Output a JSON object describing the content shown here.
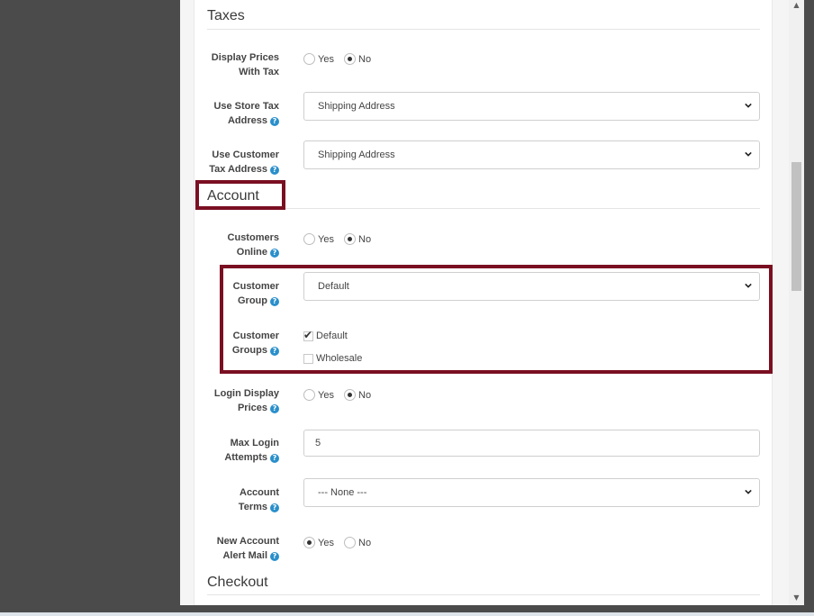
{
  "sections": {
    "taxes": "Taxes",
    "account": "Account",
    "checkout": "Checkout"
  },
  "taxes": {
    "display_prices_with_tax": {
      "label_line1": "Display Prices",
      "label_line2": "With Tax",
      "yes": "Yes",
      "no": "No",
      "selected": "No"
    },
    "use_store_tax_address": {
      "label_line1": "Use Store Tax",
      "label_line2": "Address",
      "value": "Shipping Address"
    },
    "use_customer_tax_address": {
      "label_line1": "Use Customer",
      "label_line2": "Tax Address",
      "value": "Shipping Address"
    }
  },
  "account": {
    "customers_online": {
      "label_line1": "Customers",
      "label_line2": "Online",
      "yes": "Yes",
      "no": "No",
      "selected": "No"
    },
    "customer_group": {
      "label_line1": "Customer",
      "label_line2": "Group",
      "value": "Default"
    },
    "customer_groups": {
      "label_line1": "Customer",
      "label_line2": "Groups",
      "options": [
        {
          "label": "Default",
          "checked": true
        },
        {
          "label": "Wholesale",
          "checked": false
        }
      ]
    },
    "login_display_prices": {
      "label_line1": "Login Display",
      "label_line2": "Prices",
      "yes": "Yes",
      "no": "No",
      "selected": "No"
    },
    "max_login_attempts": {
      "label_line1": "Max Login",
      "label_line2": "Attempts",
      "value": "5"
    },
    "account_terms": {
      "label_line1": "Account",
      "label_line2": "Terms",
      "value": "--- None ---"
    },
    "new_account_alert_mail": {
      "label_line1": "New Account",
      "label_line2": "Alert Mail",
      "yes": "Yes",
      "no": "No",
      "selected": "Yes"
    }
  },
  "icons": {
    "help": "question-circle-icon",
    "select": "chevron-down-icon",
    "scroll_up": "triangle-up-icon",
    "scroll_down": "triangle-down-icon"
  },
  "colors": {
    "highlight": "#7a0f22",
    "help_icon": "#2a8fcb",
    "sidebar": "#4b4b4b"
  }
}
